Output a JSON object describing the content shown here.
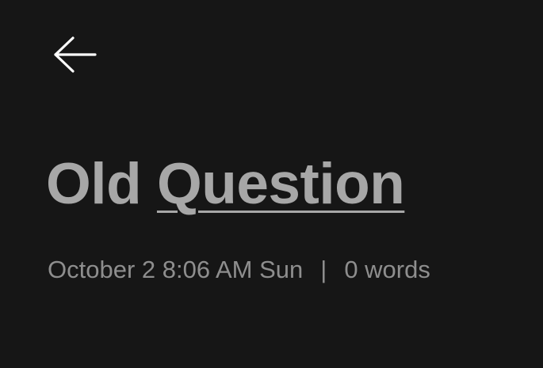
{
  "header": {
    "back_icon": "arrow-left-icon",
    "icon_color": "#ffffff"
  },
  "note": {
    "title_first": "Old",
    "title_second": "Question",
    "date": "October 2 8:06 AM Sun",
    "separator": "|",
    "word_count": "0 words"
  },
  "colors": {
    "background": "#161616",
    "title": "#a7a7a7",
    "meta": "#8e8e8e"
  }
}
